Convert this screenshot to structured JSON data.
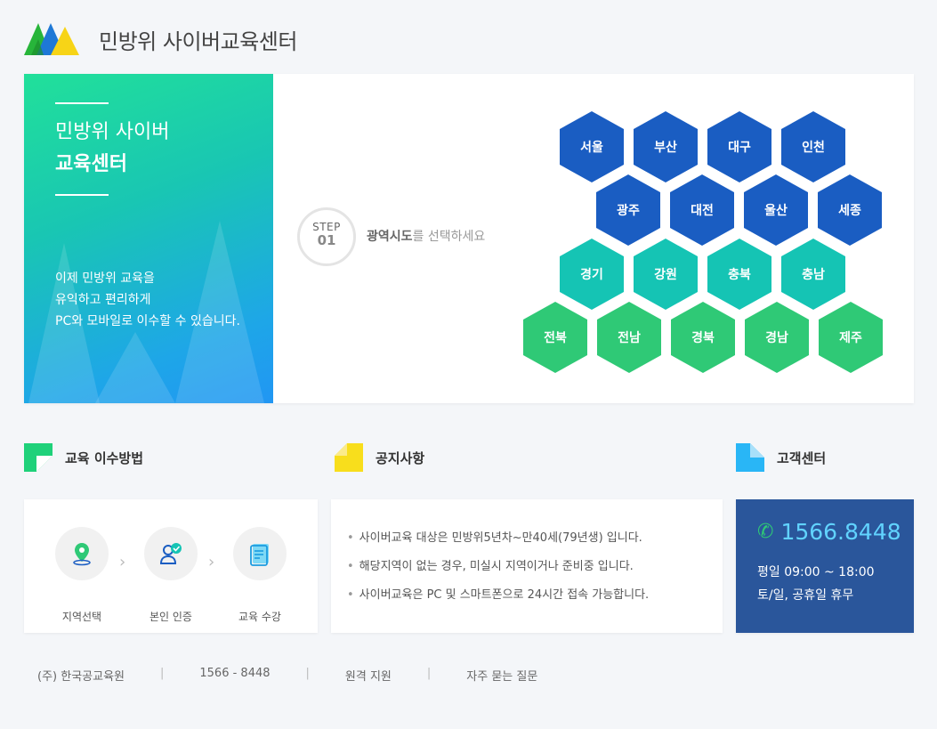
{
  "header": {
    "title": "민방위 사이버교육센터",
    "logo_icon": "mountain-logo-icon"
  },
  "hero": {
    "title_line1": "민방위 사이버",
    "title_line2": "교육센터",
    "desc_line1": "이제 민방위 교육을",
    "desc_line2": "유익하고 편리하게",
    "desc_line3": "PC와 모바일로 이수할 수 있습니다.",
    "step_label": "STEP",
    "step_number": "01",
    "step_text_bold": "광역시도",
    "step_text_rest": "를 선택하세요"
  },
  "regions": {
    "row1": [
      "서울",
      "부산",
      "대구",
      "인천"
    ],
    "row2": [
      "광주",
      "대전",
      "울산",
      "세종"
    ],
    "row3": [
      "경기",
      "강원",
      "충북",
      "충남"
    ],
    "row4": [
      "전북",
      "전남",
      "경북",
      "경남",
      "제주"
    ],
    "colors": {
      "blue": "#1a5dc2",
      "teal": "#15c4b4",
      "green": "#2fc976"
    }
  },
  "sections": {
    "method": {
      "title": "교육 이수방법",
      "icon": "green-flag-icon"
    },
    "notice": {
      "title": "공지사항",
      "icon": "yellow-note-icon"
    },
    "support": {
      "title": "고객센터",
      "icon": "blue-document-icon"
    }
  },
  "method_steps": [
    {
      "label": "지역선택",
      "icon": "map-pin-icon"
    },
    {
      "label": "본인 인증",
      "icon": "user-check-icon"
    },
    {
      "label": "교육 수강",
      "icon": "course-document-icon"
    }
  ],
  "notices": [
    "사이버교육 대상은 민방위5년차~만40세(79년생) 입니다.",
    "해당지역이 없는 경우, 미실시 지역이거나 준비중 입니다.",
    "사이버교육은 PC 및 스마트폰으로 24시간 접속 가능합니다."
  ],
  "support": {
    "phone": "1566.8448",
    "hours_weekday": "평일 09:00 ~ 18:00",
    "hours_weekend": "토/일, 공휴일 휴무"
  },
  "footer": {
    "company": "(주) 한국공교육원",
    "phone": "1566 - 8448",
    "remote": "원격 지원",
    "faq": "자주 묻는 질문",
    "separator": "|"
  }
}
